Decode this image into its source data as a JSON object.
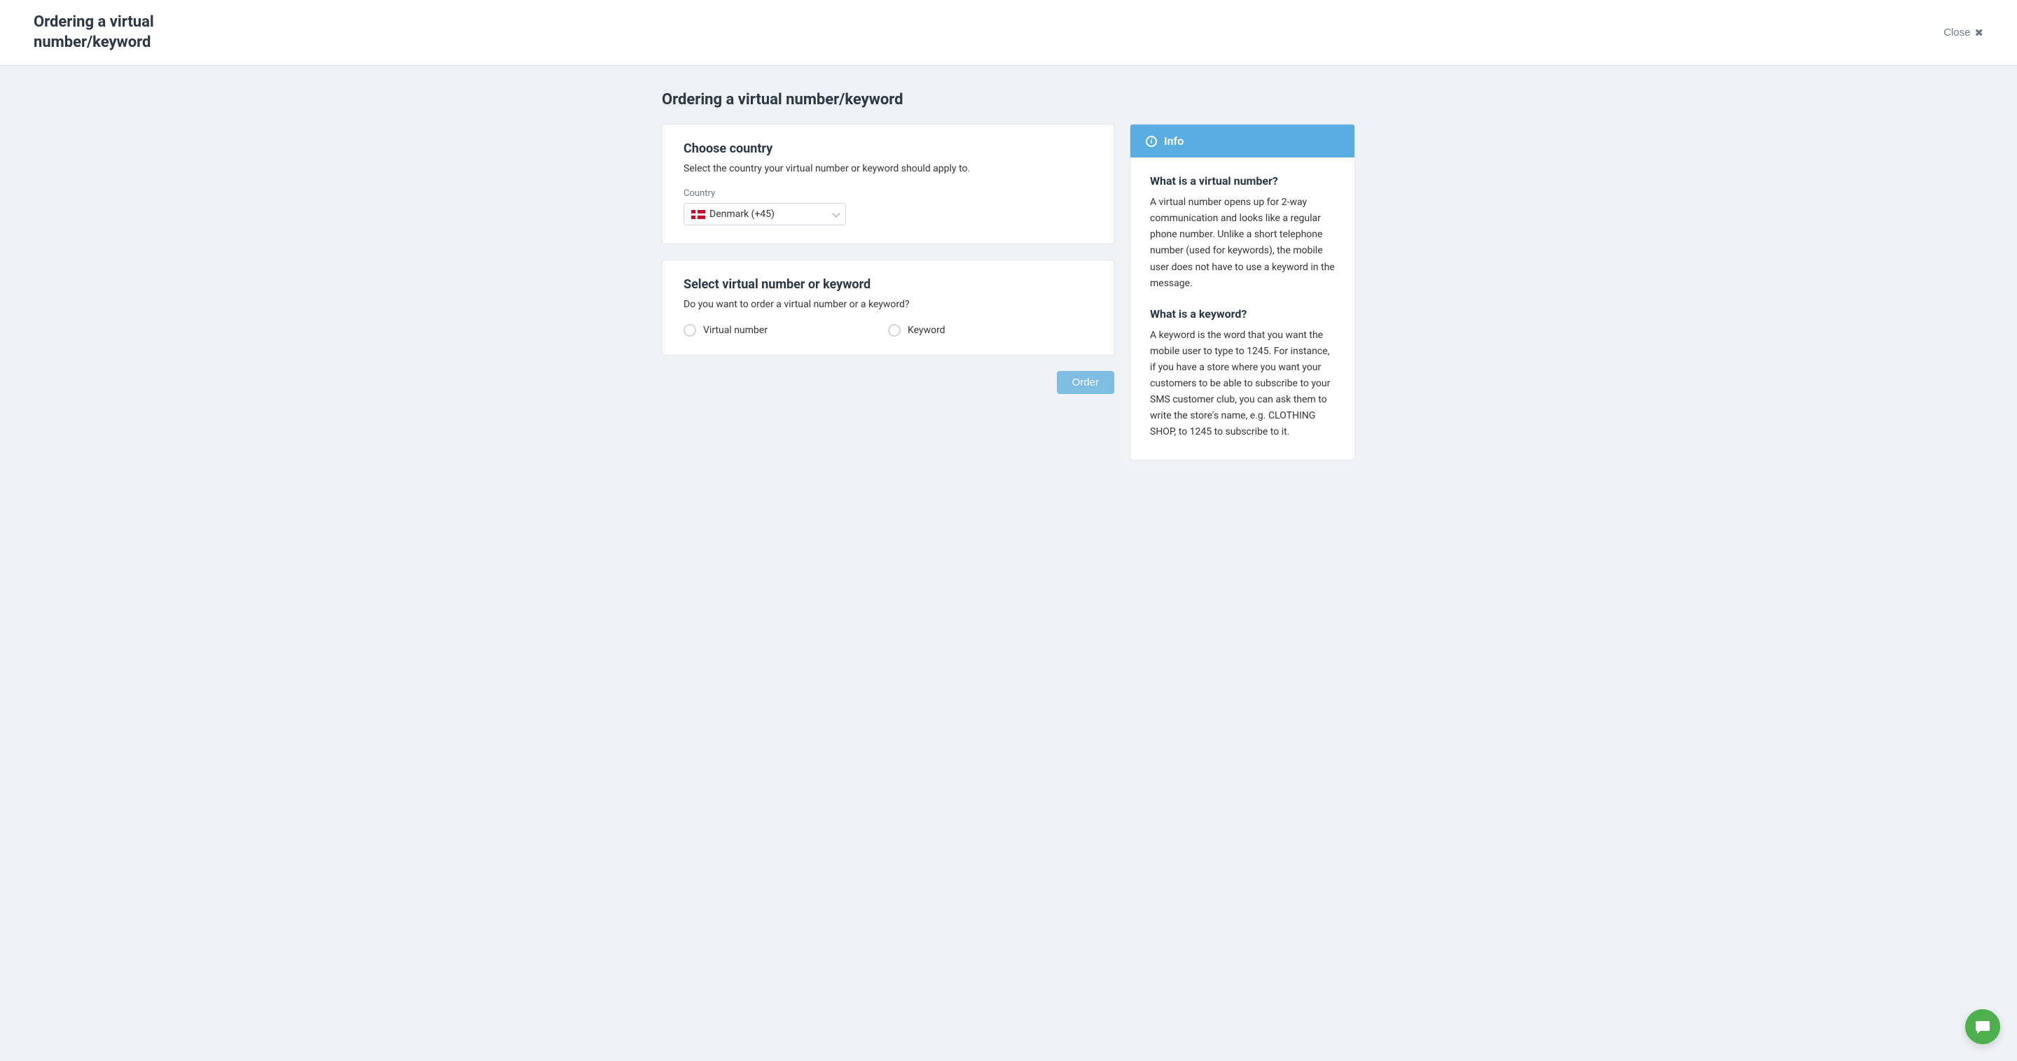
{
  "topbar": {
    "title": "Ordering a virtual number/keyword",
    "close_label": "Close"
  },
  "page": {
    "heading": "Ordering a virtual number/keyword"
  },
  "country_card": {
    "title": "Choose country",
    "subtitle": "Select the country your virtual number or keyword should apply to.",
    "field_label": "Country",
    "selected": "Denmark (+45)"
  },
  "select_card": {
    "title": "Select virtual number or keyword",
    "subtitle": "Do you want to order a virtual number or a keyword?",
    "options": [
      {
        "label": "Virtual number"
      },
      {
        "label": "Keyword"
      }
    ]
  },
  "actions": {
    "order_label": "Order"
  },
  "info": {
    "header": "Info",
    "sections": [
      {
        "heading": "What is a virtual number?",
        "body": "A virtual number opens up for 2-way communication and looks like a regular phone number. Unlike a short telephone number (used for keywords), the mobile user does not have to use a keyword in the message."
      },
      {
        "heading": "What is a keyword?",
        "body": "A keyword is the word that you want the mobile user to type to 1245. For instance, if you have a store where you want your customers to be able to subscribe to your SMS customer club, you can ask them to write the store's name, e.g. CLOTHING SHOP, to 1245 to subscribe to it."
      }
    ]
  }
}
